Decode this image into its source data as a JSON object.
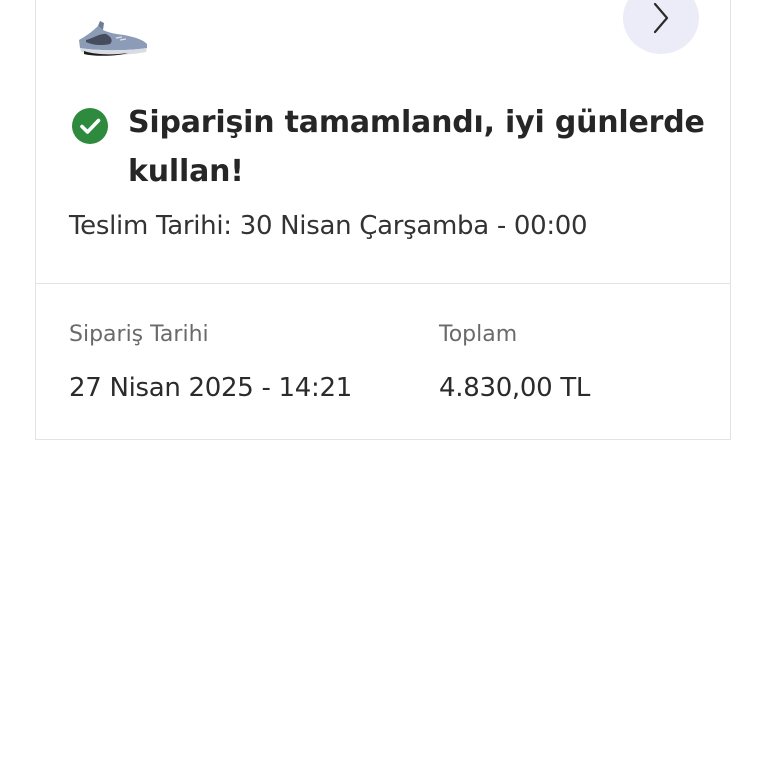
{
  "order": {
    "product_image": "sneaker-thumbnail",
    "detail_icon": "chevron-right-icon",
    "status": {
      "icon": "check-circle-icon",
      "message": "Siparişin tamamlandı, iyi günlerde kullan!",
      "color": "#2e8b3e"
    },
    "delivery": {
      "text": "Teslim Tarihi: 30 Nisan Çarşamba - 00:00"
    },
    "summary": {
      "order_date_label": "Sipariş Tarihi",
      "order_date_value": "27 Nisan 2025 - 14:21",
      "total_label": "Toplam",
      "total_value": "4.830,00 TL"
    }
  },
  "colors": {
    "accent_bg": "#ececf8",
    "success": "#2e8b3e",
    "border": "#e3e3e3"
  }
}
